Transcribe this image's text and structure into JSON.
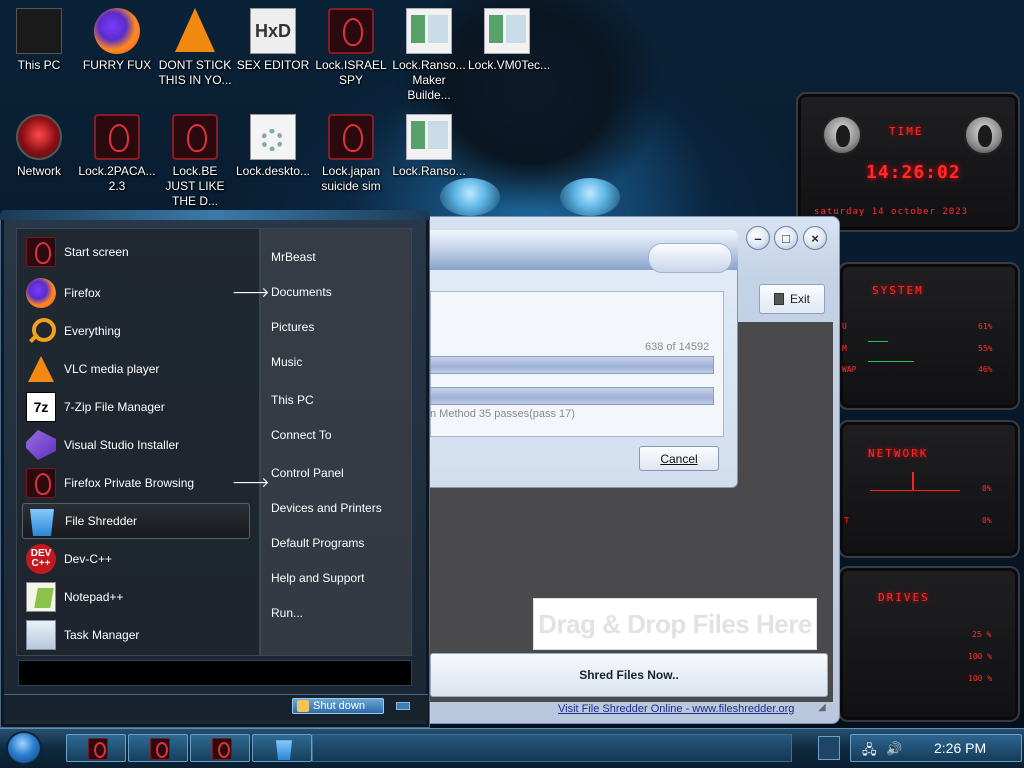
{
  "desktop": {
    "icons": [
      {
        "label": "This PC",
        "icon": "this-pc-icon"
      },
      {
        "label": "FURRY FUX",
        "icon": "firefox-icon"
      },
      {
        "label": "DONT STICK THIS IN YO...",
        "icon": "vlc-icon"
      },
      {
        "label": "SEX EDITOR",
        "icon": "hxd-icon"
      },
      {
        "label": "Lock.ISRAEL SPY",
        "icon": "alien-lock-icon"
      },
      {
        "label": "Lock.Ranso... Maker Builde...",
        "icon": "window-icon"
      },
      {
        "label": "Lock.VM0Tec...",
        "icon": "window-icon"
      },
      {
        "label": "Network",
        "icon": "network-icon"
      },
      {
        "label": "Lock.2PACA... 2.3",
        "icon": "alien-lock-icon"
      },
      {
        "label": "Lock.BE JUST LIKE THE D...",
        "icon": "alien-lock-icon"
      },
      {
        "label": "Lock.deskto...",
        "icon": "settings-file-icon"
      },
      {
        "label": "Lock.japan suicide sim",
        "icon": "alien-lock-icon"
      },
      {
        "label": "Lock.Ranso...",
        "icon": "window-icon"
      }
    ]
  },
  "gadgets": {
    "time": {
      "title": "TIME",
      "value": "14:26:02",
      "date": "saturday 14 october 2023"
    },
    "system": {
      "title": "SYSTEM",
      "rows": [
        {
          "label": "U",
          "value": "61%"
        },
        {
          "label": "M",
          "value": "55%"
        },
        {
          "label": "WAP",
          "value": "46%"
        }
      ]
    },
    "network": {
      "title": "NETWORK",
      "rows": [
        {
          "value": "0%"
        },
        {
          "label": "T",
          "value": "0%"
        }
      ]
    },
    "drives": {
      "title": "DRIVES",
      "rows": [
        {
          "value": "25 %"
        },
        {
          "value": "100 %"
        },
        {
          "value": "100 %"
        }
      ]
    },
    "accent": "#ff2a2a"
  },
  "shredder": {
    "exit_label": "Exit",
    "drop_text": "Drag & Drop Files Here",
    "shred_label": "Shred Files Now..",
    "visit_text": "Visit File Shredder Online - www.fileshredder.org"
  },
  "progress_dialog": {
    "count_current": "638",
    "count_sep": "of",
    "count_total": "14592",
    "method_text": "n Method 35 passes(pass 17)",
    "cancel_label": "Cancel"
  },
  "start_menu": {
    "programs": [
      {
        "label": "Start screen",
        "icon": "alien-icon",
        "submenu": false
      },
      {
        "label": "Firefox",
        "icon": "firefox-icon",
        "submenu": true
      },
      {
        "label": "Everything",
        "icon": "search-icon",
        "submenu": false
      },
      {
        "label": "VLC media player",
        "icon": "vlc-icon",
        "submenu": false
      },
      {
        "label": "7-Zip File Manager",
        "icon": "7zip-icon",
        "submenu": false
      },
      {
        "label": "Visual Studio Installer",
        "icon": "visual-studio-icon",
        "submenu": false
      },
      {
        "label": "Firefox Private Browsing",
        "icon": "alien-icon",
        "submenu": true
      },
      {
        "label": "File Shredder",
        "icon": "recycle-bin-icon",
        "submenu": false,
        "selected": true
      },
      {
        "label": "Dev-C++",
        "icon": "devcpp-icon",
        "submenu": false
      },
      {
        "label": "Notepad++",
        "icon": "notepadpp-icon",
        "submenu": false
      },
      {
        "label": "Task Manager",
        "icon": "task-manager-icon",
        "submenu": false
      }
    ],
    "links": [
      "MrBeast",
      "Documents",
      "Pictures",
      "Music",
      "This PC",
      "Connect To",
      "Control Panel",
      "Devices and Printers",
      "Default Programs",
      "Help and Support",
      "Run..."
    ],
    "shutdown_label": "Shut down",
    "submenu_arrow": "🡒"
  },
  "taskbar": {
    "clock": "2:26 PM",
    "tray_icons": [
      "network-tray-icon",
      "volume-icon"
    ]
  }
}
